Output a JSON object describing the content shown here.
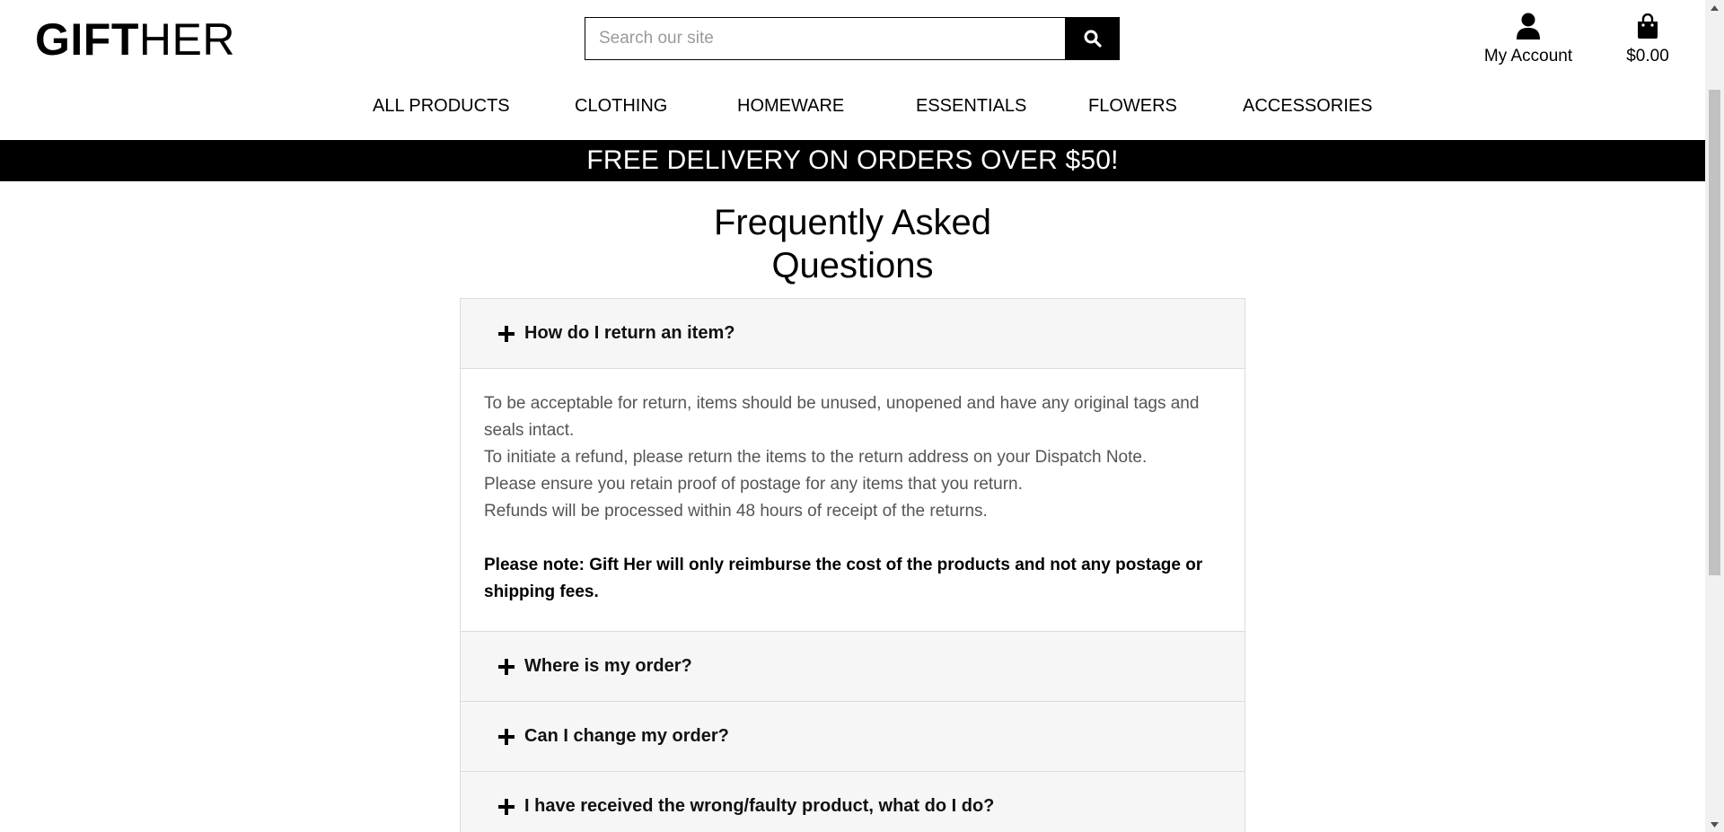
{
  "header": {
    "logo_bold": "GIFT",
    "logo_light": "HER",
    "search_placeholder": "Search our site",
    "account_label": "My Account",
    "cart_total": "$0.00"
  },
  "nav": {
    "items": [
      "ALL PRODUCTS",
      "CLOTHING",
      "HOMEWARE",
      "ESSENTIALS",
      "FLOWERS",
      "ACCESSORIES"
    ]
  },
  "banner": {
    "text": "FREE DELIVERY ON ORDERS OVER $50!"
  },
  "faq": {
    "title_line1": "Frequently Asked",
    "title_line2": "Questions",
    "items": [
      {
        "question": "How do I return an item?",
        "expanded": true,
        "answer": [
          "To be acceptable for return, items should be unused, unopened and have any original tags and seals intact.",
          "To initiate a refund, please return the items to the return address on your Dispatch Note.",
          "Please ensure you retain proof of postage for any items that you return.",
          "Refunds will be processed within 48 hours of receipt of the returns."
        ],
        "note": "Please note: Gift Her will only reimburse the cost of the products and not any postage or shipping fees."
      },
      {
        "question": "Where is my order?",
        "expanded": false
      },
      {
        "question": "Can I change my order?",
        "expanded": false
      },
      {
        "question": "I have received the wrong/faulty product, what do I do?",
        "expanded": false
      }
    ]
  },
  "icons": {
    "search": "search-icon",
    "account": "user-icon",
    "cart": "shopping-bag-icon",
    "expand": "plus-icon"
  },
  "colors": {
    "banner_bg": "#000000",
    "accordion_header_bg": "#f6f6f6",
    "body_text": "#555555"
  }
}
